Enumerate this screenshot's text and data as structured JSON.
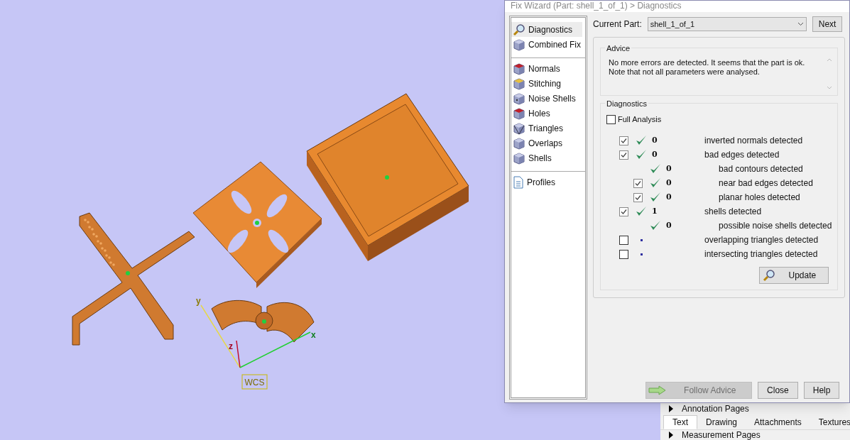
{
  "viewport": {
    "axis_labels": [
      {
        "kind": "y",
        "text": "y"
      },
      {
        "kind": "z",
        "text": "z"
      },
      {
        "kind": "x",
        "text": "x"
      }
    ],
    "wcs_label": "WCS"
  },
  "window": {
    "title": "Fix Wizard (Part: shell_1_of_1) > Diagnostics"
  },
  "nav": [
    {
      "items": [
        {
          "label": "Diagnostics",
          "selected": true
        },
        {
          "label": "Combined Fix",
          "selected": false
        }
      ]
    },
    {
      "items": [
        {
          "label": "Normals",
          "selected": false
        },
        {
          "label": "Stitching",
          "selected": false
        },
        {
          "label": "Noise Shells",
          "selected": false
        },
        {
          "label": "Holes",
          "selected": false
        },
        {
          "label": "Triangles",
          "selected": false
        },
        {
          "label": "Overlaps",
          "selected": false
        },
        {
          "label": "Shells",
          "selected": false
        }
      ]
    },
    {
      "items": [
        {
          "label": "Profiles",
          "selected": false
        }
      ]
    }
  ],
  "current_part": {
    "label": "Current Part:",
    "value": "shell_1_of_1"
  },
  "next_button": "Next",
  "advice": {
    "title": "Advice",
    "text": "No more errors are detected. It seems that the part is ok.\nNote that not all parameters were analysed."
  },
  "diagnostics": {
    "title": "Diagnostics",
    "full_analysis": {
      "label": "Full Analysis",
      "checked": false
    },
    "rows": [
      {
        "kind": "checkbox",
        "checked": true,
        "passed": true,
        "count": "0",
        "label": "inverted normals detected"
      },
      {
        "kind": "checkbox",
        "checked": true,
        "passed": true,
        "count": "0",
        "label": "bad edges detected",
        "children": [
          {
            "kind": "plain",
            "passed": true,
            "count": "0",
            "label": "bad contours detected"
          },
          {
            "kind": "checkbox",
            "checked": true,
            "passed": true,
            "count": "0",
            "label": "near bad edges detected"
          },
          {
            "kind": "checkbox",
            "checked": true,
            "passed": true,
            "count": "0",
            "label": "planar holes detected"
          }
        ]
      },
      {
        "kind": "checkbox",
        "checked": true,
        "passed": true,
        "count": "1",
        "label": "shells detected",
        "children": [
          {
            "kind": "plain",
            "passed": true,
            "count": "0",
            "label": "possible noise shells detected"
          }
        ]
      },
      {
        "kind": "checkbox",
        "checked": false,
        "passed": false,
        "label": "overlapping triangles detected"
      },
      {
        "kind": "checkbox",
        "checked": false,
        "passed": false,
        "label": "intersecting triangles detected"
      }
    ],
    "update_button": "Update"
  },
  "footer_buttons": [
    {
      "label": "Follow Advice",
      "kind": "advice",
      "disabled": true
    },
    {
      "label": "Close",
      "kind": "plain",
      "disabled": false
    },
    {
      "label": "Help",
      "kind": "plain",
      "disabled": false
    }
  ],
  "side_panel": {
    "annotation_header": "Annotation Pages",
    "tabs": [
      {
        "label": "Text",
        "selected": true
      },
      {
        "label": "Drawing",
        "selected": false
      },
      {
        "label": "Attachments",
        "selected": false
      },
      {
        "label": "Textures",
        "selected": false
      }
    ],
    "measurement_header": "Measurement Pages"
  }
}
